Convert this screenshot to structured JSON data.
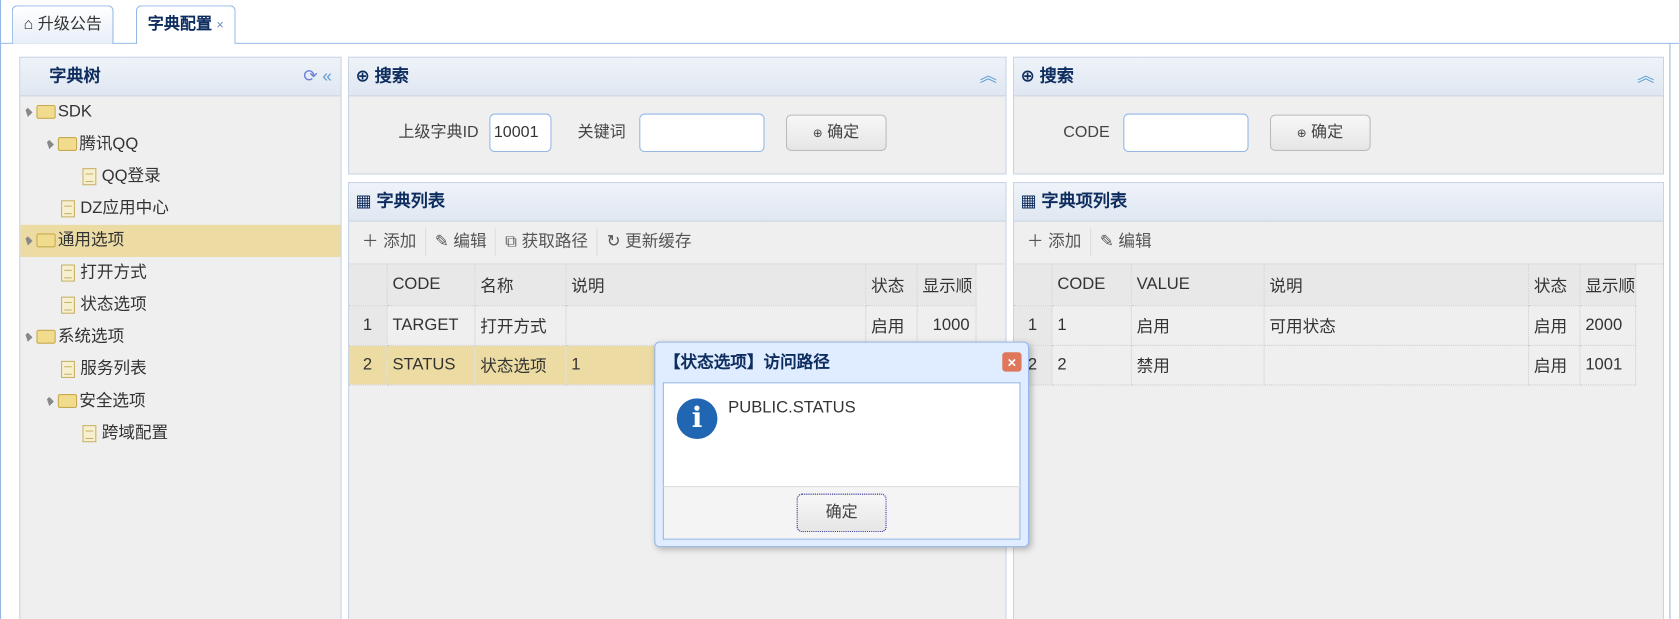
{
  "tabs": [
    {
      "label": "升级公告",
      "icon": "home-icon"
    },
    {
      "label": "字典配置",
      "close": "×"
    }
  ],
  "tree": {
    "title": "字典树",
    "items": [
      {
        "label": "SDK",
        "type": "folder",
        "level": 0
      },
      {
        "label": "腾讯QQ",
        "type": "folder",
        "level": 1
      },
      {
        "label": "QQ登录",
        "type": "file",
        "level": 2
      },
      {
        "label": "DZ应用中心",
        "type": "file",
        "level": 1
      },
      {
        "label": "通用选项",
        "type": "folder",
        "level": 0,
        "selected": true
      },
      {
        "label": "打开方式",
        "type": "file",
        "level": 1
      },
      {
        "label": "状态选项",
        "type": "file",
        "level": 1
      },
      {
        "label": "系统选项",
        "type": "folder",
        "level": 0
      },
      {
        "label": "服务列表",
        "type": "file",
        "level": 1
      },
      {
        "label": "安全选项",
        "type": "folder",
        "level": 1
      },
      {
        "label": "跨域配置",
        "type": "file",
        "level": 2
      }
    ]
  },
  "left_search": {
    "title": "搜索",
    "parent_id_label": "上级字典ID",
    "parent_id_value": "10001",
    "keyword_label": "关键词",
    "keyword_value": "",
    "confirm": "确定"
  },
  "dict_list": {
    "title": "字典列表",
    "toolbar": [
      "添加",
      "编辑",
      "获取路径",
      "更新缓存"
    ],
    "columns": [
      "CODE",
      "名称",
      "说明",
      "状态",
      "显示顺"
    ],
    "rows": [
      [
        "1",
        "TARGET",
        "打开方式",
        "",
        "启用",
        "1000"
      ],
      [
        "2",
        "STATUS",
        "状态选项",
        "1",
        "",
        ""
      ]
    ]
  },
  "right_search": {
    "title": "搜索",
    "code_label": "CODE",
    "code_value": "",
    "confirm": "确定"
  },
  "item_list": {
    "title": "字典项列表",
    "toolbar": [
      "添加",
      "编辑"
    ],
    "columns": [
      "CODE",
      "VALUE",
      "说明",
      "状态",
      "显示顺"
    ],
    "rows": [
      [
        "1",
        "1",
        "启用",
        "可用状态",
        "启用",
        "2000"
      ],
      [
        "2",
        "2",
        "禁用",
        "",
        "启用",
        "1001"
      ]
    ]
  },
  "dialog": {
    "title": "【状态选项】访问路径",
    "message": "PUBLIC.STATUS",
    "ok": "确定",
    "close": "×"
  }
}
